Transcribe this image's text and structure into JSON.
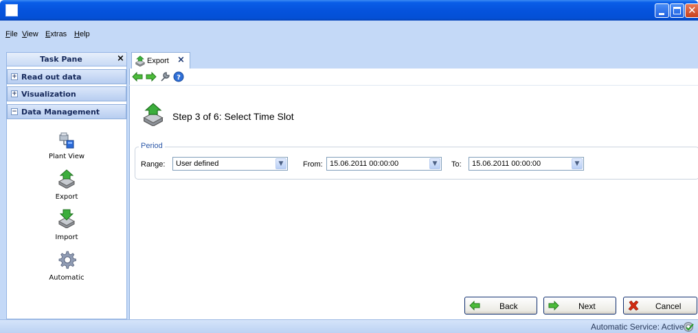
{
  "window": {
    "menu": [
      "File",
      "View",
      "Extras",
      "Help"
    ]
  },
  "task_pane": {
    "title": "Task Pane",
    "close_glyph": "×",
    "sections": [
      {
        "label": "Read out data",
        "state": "+"
      },
      {
        "label": "Visualization",
        "state": "+"
      },
      {
        "label": "Data Management",
        "state": "−"
      }
    ],
    "items": [
      {
        "label": "Plant View",
        "icon": "plant-view-icon"
      },
      {
        "label": "Export",
        "icon": "export-icon"
      },
      {
        "label": "Import",
        "icon": "import-icon"
      },
      {
        "label": "Automatic",
        "icon": "gear-icon"
      }
    ]
  },
  "tab": {
    "label": "Export",
    "close_glyph": "×"
  },
  "toolbar": {
    "icons": [
      "back-arrow-icon",
      "forward-arrow-icon",
      "wrench-icon",
      "help-icon"
    ]
  },
  "wizard": {
    "step_title": "Step 3 of 6: Select Time Slot",
    "group_label": "Period",
    "range_label": "Range:",
    "range_value": "User defined",
    "from_label": "From:",
    "from_value": "15.06.2011 00:00:00",
    "to_label": "To:",
    "to_value": "15.06.2011 00:00:00"
  },
  "buttons": {
    "back": "Back",
    "next": "Next",
    "cancel": "Cancel"
  },
  "status": {
    "text": "Automatic Service: Active"
  },
  "colors": {
    "titlebar": "#0553dd",
    "frame": "#c4d9f7",
    "accent_green": "#3cae3c",
    "cancel_red": "#d12a10"
  }
}
